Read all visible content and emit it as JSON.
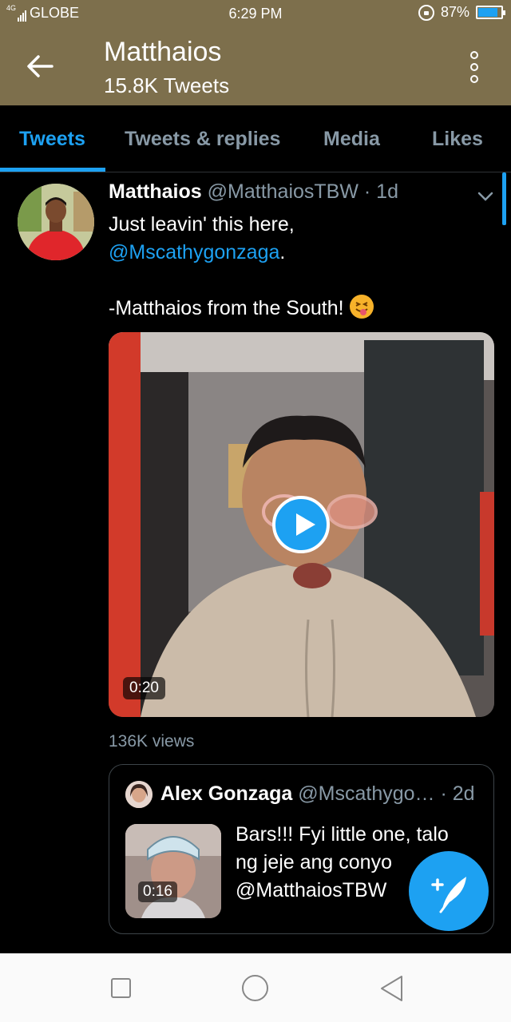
{
  "status_bar": {
    "network_type": "4G",
    "carrier": "GLOBE",
    "time": "6:29 PM",
    "battery_percent_label": "87%",
    "battery_level": 0.87
  },
  "header": {
    "title": "Matthaios",
    "subtitle": "15.8K Tweets"
  },
  "tabs": [
    {
      "label": "Tweets",
      "active": true
    },
    {
      "label": "Tweets & replies",
      "active": false
    },
    {
      "label": "Media",
      "active": false
    },
    {
      "label": "Likes",
      "active": false
    }
  ],
  "tweet": {
    "author_name": "Matthaios",
    "author_handle": "@MatthaiosTBW",
    "time_sep": " · ",
    "time": "1d",
    "text_line1": "Just leavin' this here,",
    "mention": "@Mscathygonzaga",
    "mention_suffix": ".",
    "text_line3": "-Matthaios from the South!",
    "emoji_name": "squinting-tongue-face-emoji",
    "video_duration": "0:20",
    "views": "136K views",
    "quoted": {
      "author_name": "Alex Gonzaga",
      "author_handle": "@Mscathygo…",
      "time_sep": " · ",
      "time": "2d",
      "video_duration": "0:16",
      "text_line1": "Bars!!! Fyi little one, talo",
      "text_line2": "ng jeje ang conyo",
      "text_line3": "@MatthaiosTBW"
    }
  },
  "icons": {
    "back": "arrow-left-icon",
    "more": "more-vertical-icon",
    "caret": "chevron-down-icon",
    "compose": "compose-feather-icon",
    "play": "play-icon"
  },
  "colors": {
    "header_bg": "#7d6f4c",
    "accent": "#1da1f2",
    "muted": "#8899a6",
    "background": "#000000"
  }
}
